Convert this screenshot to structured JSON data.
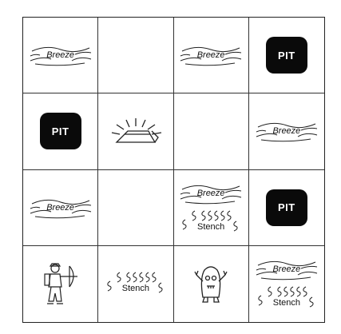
{
  "board": {
    "rows": 4,
    "cols": 4,
    "cells": [
      {
        "row": 0,
        "col": 0,
        "items": [
          {
            "kind": "breeze",
            "label": "Breeze"
          }
        ]
      },
      {
        "row": 0,
        "col": 1,
        "items": []
      },
      {
        "row": 0,
        "col": 2,
        "items": [
          {
            "kind": "breeze",
            "label": "Breeze"
          }
        ]
      },
      {
        "row": 0,
        "col": 3,
        "items": [
          {
            "kind": "pit",
            "label": "PIT"
          }
        ]
      },
      {
        "row": 1,
        "col": 0,
        "items": [
          {
            "kind": "pit",
            "label": "PIT"
          }
        ]
      },
      {
        "row": 1,
        "col": 1,
        "items": [
          {
            "kind": "gold",
            "icon": "gold-bar-icon"
          }
        ]
      },
      {
        "row": 1,
        "col": 2,
        "items": []
      },
      {
        "row": 1,
        "col": 3,
        "items": [
          {
            "kind": "breeze",
            "label": "Breeze"
          }
        ]
      },
      {
        "row": 2,
        "col": 0,
        "items": [
          {
            "kind": "breeze",
            "label": "Breeze"
          }
        ]
      },
      {
        "row": 2,
        "col": 1,
        "items": []
      },
      {
        "row": 2,
        "col": 2,
        "items": [
          {
            "kind": "breeze",
            "label": "Breeze"
          },
          {
            "kind": "stench",
            "label": "Stench"
          }
        ]
      },
      {
        "row": 2,
        "col": 3,
        "items": [
          {
            "kind": "pit",
            "label": "PIT"
          }
        ]
      },
      {
        "row": 3,
        "col": 0,
        "items": [
          {
            "kind": "agent",
            "icon": "agent-archer-icon"
          }
        ]
      },
      {
        "row": 3,
        "col": 1,
        "items": [
          {
            "kind": "stench",
            "label": "Stench"
          }
        ]
      },
      {
        "row": 3,
        "col": 2,
        "items": [
          {
            "kind": "wumpus",
            "icon": "wumpus-monster-icon"
          }
        ]
      },
      {
        "row": 3,
        "col": 3,
        "items": [
          {
            "kind": "breeze",
            "label": "Breeze"
          },
          {
            "kind": "stench",
            "label": "Stench"
          }
        ]
      }
    ]
  }
}
